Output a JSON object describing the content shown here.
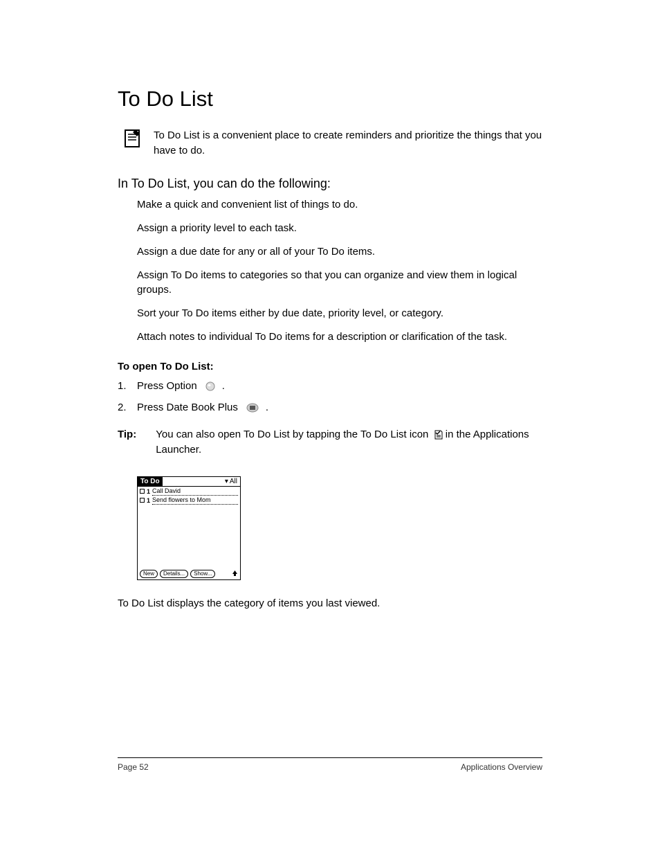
{
  "title": "To Do List",
  "intro": "To Do List is a convenient place to create reminders and prioritize the things that you have to do.",
  "subhead": "In To Do List, you can do the following:",
  "features": [
    "Make a quick and convenient list of things to do.",
    "Assign a priority level to each task.",
    "Assign a due date for any or all of your To Do items.",
    "Assign To Do items to categories so that you can organize and view them in logical groups.",
    "Sort your To Do items either by due date, priority level, or category.",
    "Attach notes to individual To Do items for a description or clarification of the task."
  ],
  "open_heading": "To open To Do List:",
  "steps": [
    {
      "num": "1.",
      "text": "Press Option"
    },
    {
      "num": "2.",
      "text": "Press Date Book Plus"
    }
  ],
  "tip_label": "Tip:",
  "tip_pre": "You can also open To Do List by tapping the To Do List icon",
  "tip_post": "in the Applications Launcher.",
  "mock": {
    "title": "To Do",
    "category": "All",
    "items": [
      {
        "priority": "1",
        "text": "Call David"
      },
      {
        "priority": "1",
        "text": "Send flowers to Mom"
      }
    ],
    "buttons": [
      "New",
      "Details...",
      "Show..."
    ]
  },
  "caption": "To Do List displays the category of items you last viewed.",
  "footer_left": "Page 52",
  "footer_right": "Applications Overview"
}
